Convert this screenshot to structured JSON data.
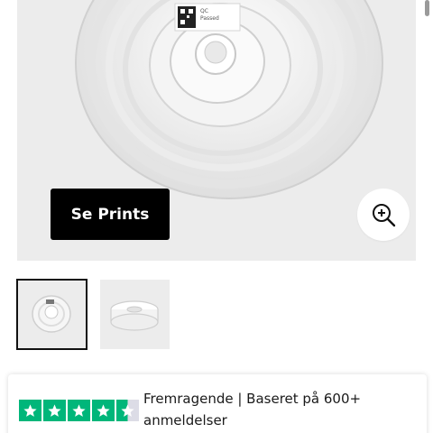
{
  "gallery": {
    "label_lines": [
      "QC",
      "Passed"
    ],
    "cta_label": "Se Prints",
    "zoom_icon": "zoom-in-icon"
  },
  "thumbnails": [
    {
      "name": "spool-front",
      "active": true
    },
    {
      "name": "spool-side",
      "active": false
    }
  ],
  "reviews": {
    "rating_stars": 4.5,
    "star_color": "#00b67a",
    "text": "Fremragende | Baseret på 600+ anmeldelser"
  }
}
